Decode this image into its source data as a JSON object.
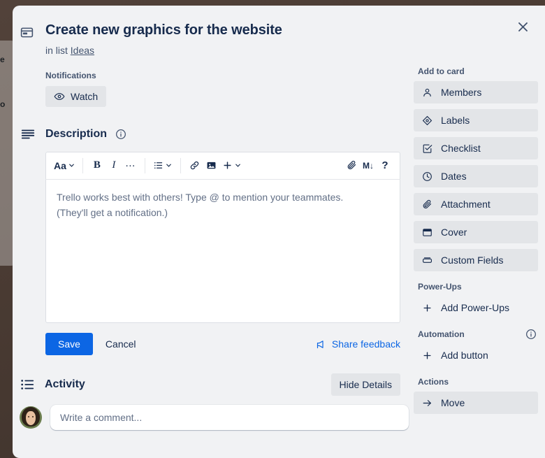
{
  "backdrop": {
    "peek_text_top": "e",
    "peek_text_bottom": "o"
  },
  "header": {
    "card_icon": "card-icon",
    "title": "Create new graphics for the website",
    "in_list_prefix": "in list",
    "list_name": "Ideas",
    "close_icon": "close-icon"
  },
  "notifications": {
    "label": "Notifications",
    "watch_label": "Watch",
    "watch_icon": "eye-icon"
  },
  "description": {
    "section_icon": "description-lines-icon",
    "title": "Description",
    "info_icon": "info-circle-icon",
    "toolbar": {
      "font_label": "Aa",
      "font_chevron": "chevron-down-icon",
      "bold_label": "B",
      "italic_label": "I",
      "more_label": "…",
      "list_icon": "bulleted-list-icon",
      "list_chevron": "chevron-down-icon",
      "link_icon": "link-icon",
      "image_icon": "image-icon",
      "plus_label": "+",
      "plus_chevron": "chevron-down-icon",
      "attach_icon": "paperclip-icon",
      "markdown_label": "M↓",
      "help_label": "?"
    },
    "placeholder_line1": "Trello works best with others! Type @ to mention your teammates.",
    "placeholder_line2": "(They'll get a notification.)",
    "save_label": "Save",
    "cancel_label": "Cancel",
    "feedback_label": "Share feedback",
    "feedback_icon": "megaphone-icon"
  },
  "activity": {
    "section_icon": "activity-list-icon",
    "title": "Activity",
    "hide_details_label": "Hide Details",
    "avatar": "user-avatar",
    "comment_placeholder": "Write a comment..."
  },
  "sidebar": {
    "add_to_card": {
      "label": "Add to card",
      "items": [
        {
          "label": "Members",
          "icon": "person-icon"
        },
        {
          "label": "Labels",
          "icon": "tag-icon"
        },
        {
          "label": "Checklist",
          "icon": "checkbox-icon"
        },
        {
          "label": "Dates",
          "icon": "clock-icon"
        },
        {
          "label": "Attachment",
          "icon": "paperclip-icon"
        },
        {
          "label": "Cover",
          "icon": "cover-card-icon"
        },
        {
          "label": "Custom Fields",
          "icon": "custom-fields-icon"
        }
      ]
    },
    "power_ups": {
      "label": "Power-Ups",
      "items": [
        {
          "label": "Add Power-Ups",
          "icon": "plus-icon"
        }
      ]
    },
    "automation": {
      "label": "Automation",
      "info_icon": "info-circle-icon",
      "items": [
        {
          "label": "Add button",
          "icon": "plus-icon"
        }
      ]
    },
    "actions": {
      "label": "Actions",
      "items": [
        {
          "label": "Move",
          "icon": "arrow-right-icon"
        }
      ]
    }
  },
  "colors": {
    "accent": "#0c66e4",
    "modal_bg": "#f1f2f4",
    "button_bg": "#e3e5e8",
    "text": "#172b4d",
    "muted": "#44546f"
  }
}
